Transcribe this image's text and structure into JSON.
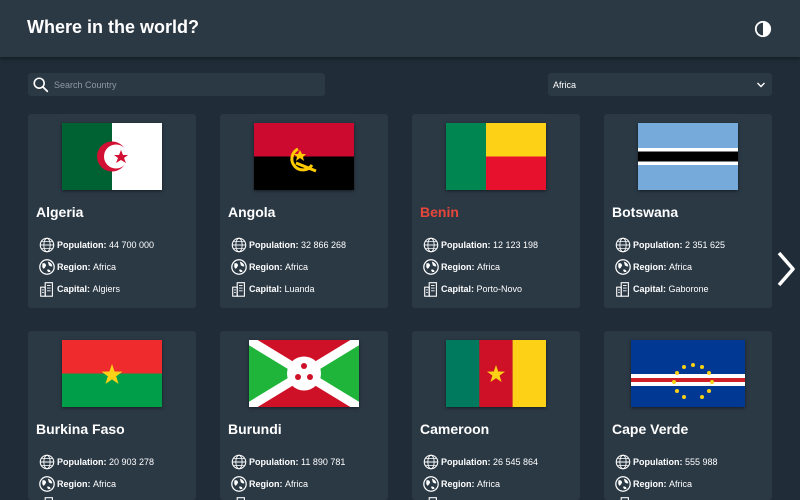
{
  "header": {
    "title": "Where in the world?",
    "theme_icon": "contrast-icon"
  },
  "search": {
    "placeholder": "Search Country",
    "value": ""
  },
  "filter": {
    "selected": "Africa"
  },
  "labels": {
    "population": "Population:",
    "region": "Region:",
    "capital": "Capital:"
  },
  "countries": [
    {
      "name": "Algeria",
      "population": "44 700 000",
      "region": "Africa",
      "capital": "Algiers",
      "flag": "algeria-flag"
    },
    {
      "name": "Angola",
      "population": "32 866 268",
      "region": "Africa",
      "capital": "Luanda",
      "flag": "angola-flag"
    },
    {
      "name": "Benin",
      "population": "12 123 198",
      "region": "Africa",
      "capital": "Porto-Novo",
      "flag": "benin-flag"
    },
    {
      "name": "Botswana",
      "population": "2 351 625",
      "region": "Africa",
      "capital": "Gaborone",
      "flag": "botswana-flag"
    },
    {
      "name": "Burkina Faso",
      "population": "20 903 278",
      "region": "Africa",
      "capital": "",
      "flag": "burkina-faso-flag"
    },
    {
      "name": "Burundi",
      "population": "11 890 781",
      "region": "Africa",
      "capital": "",
      "flag": "burundi-flag"
    },
    {
      "name": "Cameroon",
      "population": "26 545 864",
      "region": "Africa",
      "capital": "",
      "flag": "cameroon-flag"
    },
    {
      "name": "Cape Verde",
      "population": "555 988",
      "region": "Africa",
      "capital": "",
      "flag": "cape-verde-flag"
    }
  ],
  "colors": {
    "background": "#202c37",
    "card": "#2b3945",
    "highlight": "#e8463a"
  }
}
